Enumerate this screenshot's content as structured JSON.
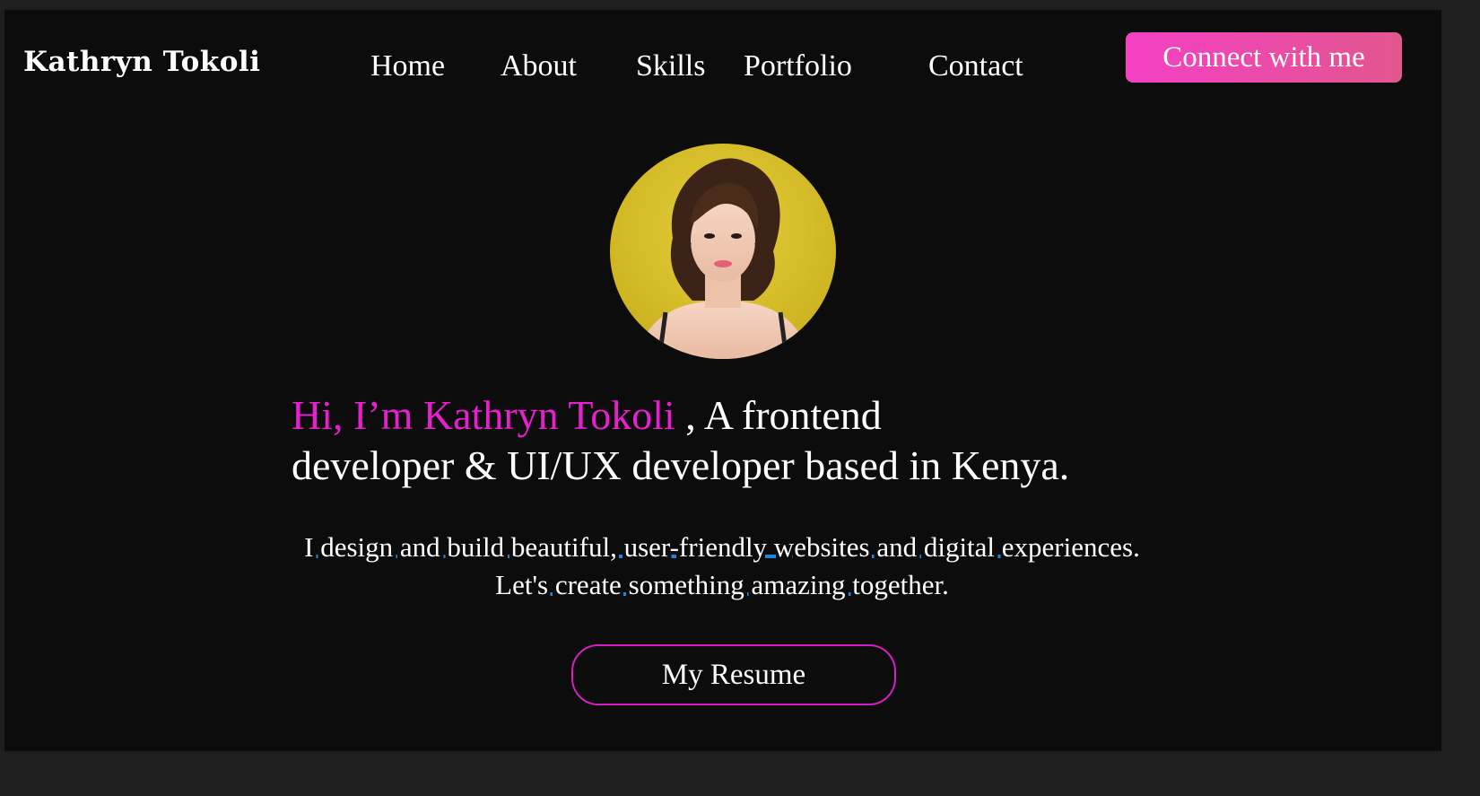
{
  "header": {
    "logo": "Kathryn Tokoli",
    "nav": [
      "Home",
      "About",
      "Skills",
      "Portfolio",
      "Contact"
    ],
    "cta_label": "Connect with me"
  },
  "hero": {
    "photo_icon": "profile-photo",
    "greeting": "Hi, I’m Kathryn Tokoli",
    "headline_rest_1": " , A frontend",
    "headline_rest_2": "developer & UI/UX developer based in Kenya.",
    "sub_line_1": "I design and build beautiful, user-friendly websites and digital experiences.",
    "sub_line_2": "Let's create something amazing together.",
    "resume_label": "My Resume"
  },
  "colors": {
    "accent_pink": "#e71fcf",
    "underline_blue": "#1d86de",
    "cta_gradient_start": "#f43fc4",
    "cta_gradient_end": "#e2578e",
    "page_background": "#0c0c0c"
  }
}
